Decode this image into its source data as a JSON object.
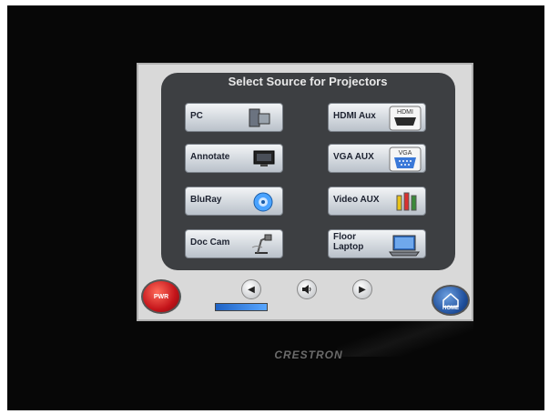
{
  "panel": {
    "title": "Select Source for Projectors"
  },
  "sources_left": [
    {
      "label": "PC",
      "icon": "pc-tower-icon"
    },
    {
      "label": "Annotate",
      "icon": "monitor-icon"
    },
    {
      "label": "BluRay",
      "icon": "disc-icon"
    },
    {
      "label": "Doc Cam",
      "icon": "document-camera-icon"
    }
  ],
  "sources_right": [
    {
      "label": "HDMI Aux",
      "icon": "hdmi-port-icon",
      "icon_text": "HDMI"
    },
    {
      "label": "VGA AUX",
      "icon": "vga-port-icon",
      "icon_text": "VGA"
    },
    {
      "label": "Video AUX",
      "icon": "rca-jacks-icon"
    },
    {
      "label": "Floor Laptop",
      "icon": "laptop-icon"
    }
  ],
  "controls": {
    "power_label": "PWR",
    "home_label": "HOME",
    "prev_icon": "left-arrow-icon",
    "mute_icon": "speaker-icon",
    "next_icon": "right-arrow-icon",
    "volume_level": 1.0
  },
  "device": {
    "brand": "CRESTRON"
  },
  "colors": {
    "panel_bg": "#3d3f42",
    "screen_bg": "#d9d9d9",
    "power_red": "#c4141a",
    "home_blue": "#1f4f9c",
    "volume_blue": "#1e62c4"
  }
}
